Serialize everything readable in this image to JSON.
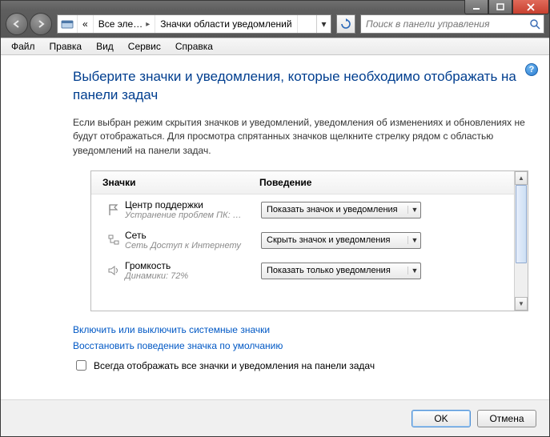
{
  "titlebar": {
    "min": "_",
    "max": "□",
    "close": "✕"
  },
  "nav": {
    "crumbs": [
      "«",
      "Все эле…",
      "Значки области уведомлений"
    ],
    "search_placeholder": "Поиск в панели управления"
  },
  "menu": [
    "Файл",
    "Правка",
    "Вид",
    "Сервис",
    "Справка"
  ],
  "page": {
    "title": "Выберите значки и уведомления, которые необходимо отображать на панели задач",
    "desc": "Если выбран режим скрытия значков и уведомлений, уведомления об изменениях и обновлениях не будут отображаться. Для просмотра спрятанных значков щелкните стрелку рядом с областью уведомлений на панели задач.",
    "col_icons": "Значки",
    "col_behavior": "Поведение",
    "rows": [
      {
        "label": "Центр поддержки",
        "sub": "Устранение проблем ПК: …",
        "value": "Показать значок и уведомления"
      },
      {
        "label": "Сеть",
        "sub": "Сеть Доступ к Интернету",
        "value": "Скрыть значок и уведомления"
      },
      {
        "label": "Громкость",
        "sub": "Динамики: 72%",
        "value": "Показать только уведомления"
      }
    ],
    "link1": "Включить или выключить системные значки",
    "link2": "Восстановить поведение значка по умолчанию",
    "checkbox": "Всегда отображать все значки и уведомления на панели задач",
    "ok": "OK",
    "cancel": "Отмена"
  }
}
